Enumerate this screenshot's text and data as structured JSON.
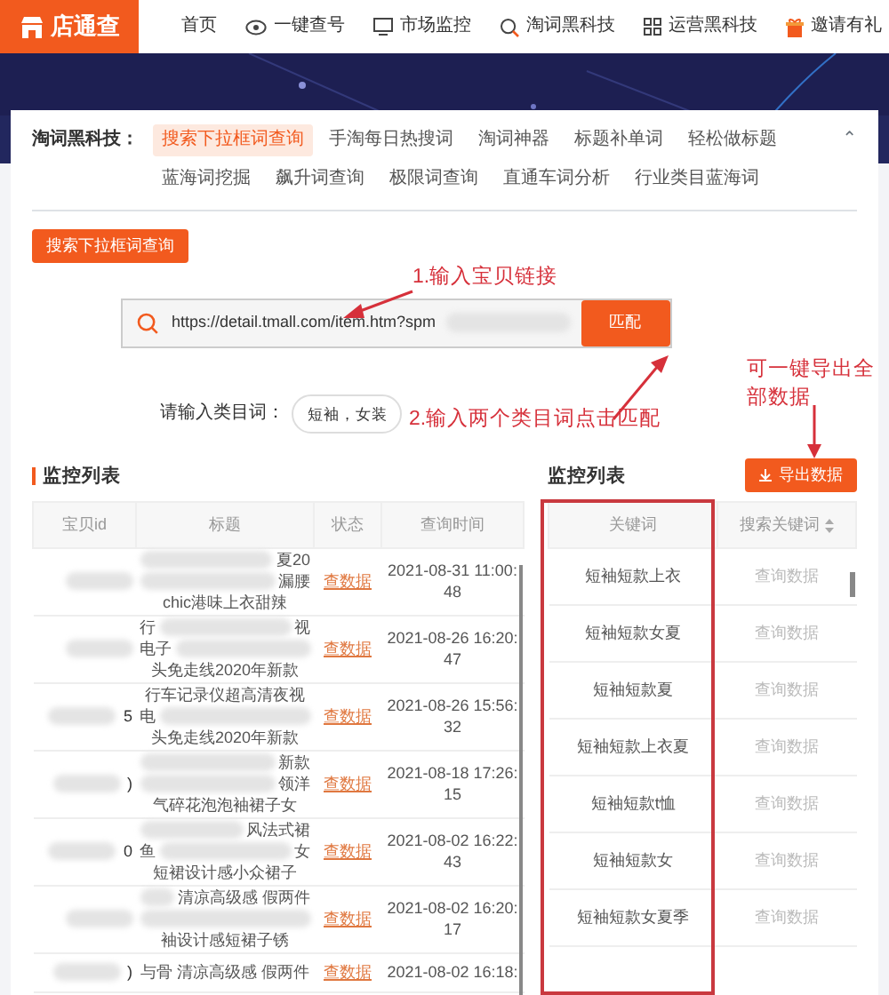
{
  "logo": {
    "text": "店通查"
  },
  "nav": [
    {
      "label": "首页"
    },
    {
      "label": "一键查号"
    },
    {
      "label": "市场监控"
    },
    {
      "label": "淘词黑科技"
    },
    {
      "label": "运营黑科技"
    },
    {
      "label": "邀请有礼"
    }
  ],
  "category_bar": {
    "label": "淘词黑科技：",
    "collapse": "⌃",
    "items": [
      {
        "label": "搜索下拉框词查询",
        "selected": true
      },
      {
        "label": "手淘每日热搜词",
        "selected": false
      },
      {
        "label": "淘词神器",
        "selected": false
      },
      {
        "label": "标题补单词",
        "selected": false
      },
      {
        "label": "轻松做标题",
        "selected": false
      },
      {
        "label": "蓝海词挖掘",
        "selected": false
      },
      {
        "label": "飙升词查询",
        "selected": false
      },
      {
        "label": "极限词查询",
        "selected": false
      },
      {
        "label": "直通车词分析",
        "selected": false
      },
      {
        "label": "行业类目蓝海词",
        "selected": false
      }
    ]
  },
  "tool_button": "搜索下拉框词查询",
  "link_field": {
    "value": "https://detail.tmall.com/item.htm?spm",
    "button": "匹配"
  },
  "category_field": {
    "label": "请输入类目词：",
    "value": "短袖，女装"
  },
  "annotations": [
    "1.输入宝贝链接",
    "2.输入两个类目词点击匹配",
    "可一键导出全部数据"
  ],
  "left_panel": {
    "title": "监控列表",
    "columns": [
      "宝贝id",
      "标题",
      "状态",
      "查询时间"
    ],
    "rows": [
      {
        "title": [
          {
            "right": "夏20"
          },
          {
            "right": "漏腰"
          },
          {
            "text": "chic港味上衣甜辣"
          }
        ],
        "status": "查数据",
        "time": "2021-08-31 11:00:48"
      },
      {
        "title": [
          {
            "left": "行",
            "right": "视"
          },
          {
            "left": "电子"
          },
          {
            "text": "头免走线2020年新款"
          }
        ],
        "status": "查数据",
        "time": "2021-08-26 16:20:47"
      },
      {
        "id_tail": "5",
        "title": [
          {
            "text": "行车记录仪超高清夜视"
          },
          {
            "left": "电"
          },
          {
            "text": "头免走线2020年新款"
          }
        ],
        "status": "查数据",
        "time": "2021-08-26 15:56:32"
      },
      {
        "id_tail": ")",
        "title": [
          {
            "right": "新款"
          },
          {
            "right": "领洋"
          },
          {
            "text": "气碎花泡泡袖裙子女"
          }
        ],
        "status": "查数据",
        "time": "2021-08-18 17:26:15"
      },
      {
        "id_tail": "0",
        "title": [
          {
            "right": "风法式裙"
          },
          {
            "left": "鱼",
            "right": "女"
          },
          {
            "text": "短裙设计感小众裙子"
          }
        ],
        "status": "查数据",
        "time": "2021-08-02 16:22:43"
      },
      {
        "title": [
          {
            "right": "清凉高级感 假两件"
          },
          {
            "blurred": true
          },
          {
            "text": "袖设计感短裙子锈"
          }
        ],
        "status": "查数据",
        "time": "2021-08-02 16:20:17"
      },
      {
        "id_tail": ")",
        "title": [
          {
            "text": "与骨 清凉高级感 假两件"
          }
        ],
        "status": "查数据",
        "time": "2021-08-02 16:18:"
      }
    ]
  },
  "right_panel": {
    "title": "监控列表",
    "export_button": "导出数据",
    "columns": [
      "关键词",
      "搜索关键词"
    ],
    "rows": [
      {
        "keyword": "短袖短款上衣",
        "action": "查询数据"
      },
      {
        "keyword": "短袖短款女夏",
        "action": "查询数据"
      },
      {
        "keyword": "短袖短款夏",
        "action": "查询数据"
      },
      {
        "keyword": "短袖短款上衣夏",
        "action": "查询数据"
      },
      {
        "keyword": "短袖短款t恤",
        "action": "查询数据"
      },
      {
        "keyword": "短袖短款女",
        "action": "查询数据"
      },
      {
        "keyword": "短袖短款女夏季",
        "action": "查询数据"
      }
    ]
  }
}
